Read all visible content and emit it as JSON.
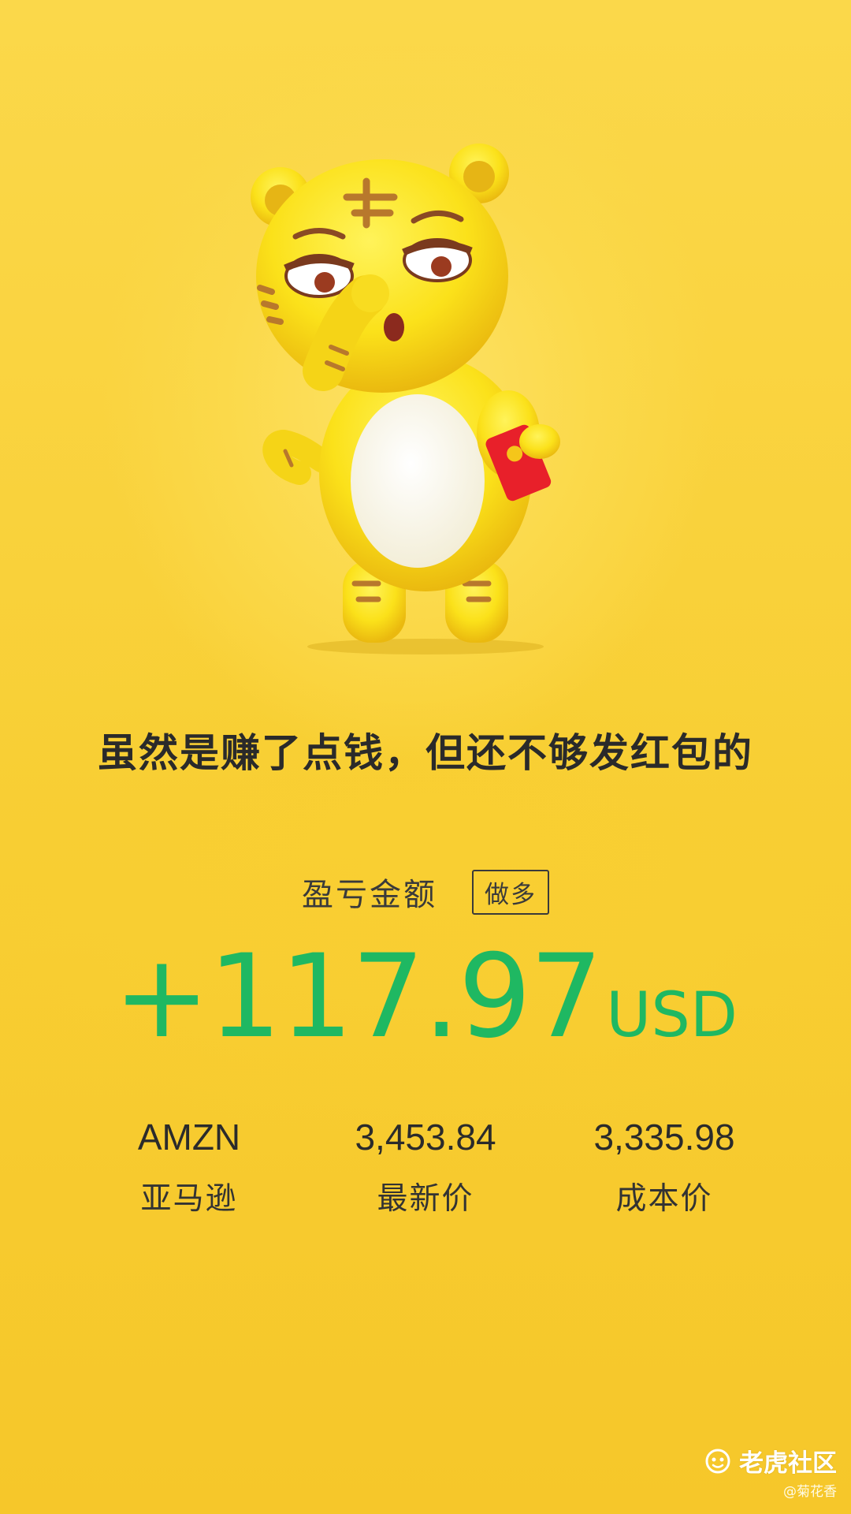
{
  "headline": "虽然是赚了点钱，但还不够发红包的",
  "pnl": {
    "label": "盈亏金额",
    "direction_badge": "做多",
    "amount": "+117.97",
    "currency": "USD"
  },
  "stats": [
    {
      "value": "AMZN",
      "caption": "亚马逊"
    },
    {
      "value": "3,453.84",
      "caption": "最新价"
    },
    {
      "value": "3,335.98",
      "caption": "成本价"
    }
  ],
  "watermark": {
    "brand": "老虎社区",
    "user": "@菊花香"
  },
  "colors": {
    "background": "#f8ce33",
    "profit_green": "#1fb862",
    "text_dark": "#2a2a2a"
  },
  "icons": {
    "mascot": "tiger-mascot-illustration",
    "brand_logo": "tiger-community-logo-icon"
  }
}
